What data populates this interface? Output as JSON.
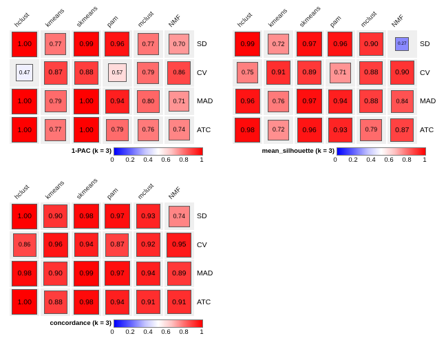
{
  "columns": [
    "hclust",
    "kmeans",
    "skmeans",
    "pam",
    "mclust",
    "NMF"
  ],
  "rows": [
    "SD",
    "CV",
    "MAD",
    "ATC"
  ],
  "legend_ticks": [
    "0",
    "0.2",
    "0.4",
    "0.6",
    "0.8",
    "1"
  ],
  "legend_tick_values": [
    0,
    0.2,
    0.4,
    0.6,
    0.8,
    1
  ],
  "chart_data": [
    {
      "type": "heatmap",
      "title": "1-PAC (k = 3)",
      "xlabel": "",
      "ylabel": "",
      "categories": [
        "hclust",
        "kmeans",
        "skmeans",
        "pam",
        "mclust",
        "NMF"
      ],
      "rows": [
        "SD",
        "CV",
        "MAD",
        "ATC"
      ],
      "zlim": [
        0,
        1
      ],
      "colormap": "blue-white-red",
      "legend_position": "bottom",
      "grid": true,
      "values": [
        [
          1.0,
          0.77,
          0.99,
          0.96,
          0.77,
          0.7
        ],
        [
          0.47,
          0.87,
          0.88,
          0.57,
          0.79,
          0.86
        ],
        [
          1.0,
          0.79,
          1.0,
          0.94,
          0.8,
          0.71
        ],
        [
          1.0,
          0.77,
          1.0,
          0.79,
          0.76,
          0.74
        ]
      ],
      "labels": [
        [
          "1.00",
          "0.77",
          "0.99",
          "0.96",
          "0.77",
          "0.70"
        ],
        [
          "0.47",
          "0.87",
          "0.88",
          "0.57",
          "0.79",
          "0.86"
        ],
        [
          "1.00",
          "0.79",
          "1.00",
          "0.94",
          "0.80",
          "0.71"
        ],
        [
          "1.00",
          "0.77",
          "1.00",
          "0.79",
          "0.76",
          "0.74"
        ]
      ]
    },
    {
      "type": "heatmap",
      "title": "mean_silhouette (k = 3)",
      "xlabel": "",
      "ylabel": "",
      "categories": [
        "hclust",
        "kmeans",
        "skmeans",
        "pam",
        "mclust",
        "NMF"
      ],
      "rows": [
        "SD",
        "CV",
        "MAD",
        "ATC"
      ],
      "zlim": [
        0,
        1
      ],
      "colormap": "blue-white-red",
      "legend_position": "bottom",
      "grid": true,
      "values": [
        [
          0.99,
          0.72,
          0.97,
          0.96,
          0.9,
          0.27
        ],
        [
          0.75,
          0.91,
          0.89,
          0.71,
          0.88,
          0.9
        ],
        [
          0.96,
          0.76,
          0.97,
          0.94,
          0.88,
          0.84
        ],
        [
          0.98,
          0.72,
          0.96,
          0.93,
          0.79,
          0.87
        ]
      ],
      "labels": [
        [
          "0.99",
          "0.72",
          "0.97",
          "0.96",
          "0.90",
          "0.27"
        ],
        [
          "0.75",
          "0.91",
          "0.89",
          "0.71",
          "0.88",
          "0.90"
        ],
        [
          "0.96",
          "0.76",
          "0.97",
          "0.94",
          "0.88",
          "0.84"
        ],
        [
          "0.98",
          "0.72",
          "0.96",
          "0.93",
          "0.79",
          "0.87"
        ]
      ]
    },
    {
      "type": "heatmap",
      "title": "concordance (k = 3)",
      "xlabel": "",
      "ylabel": "",
      "categories": [
        "hclust",
        "kmeans",
        "skmeans",
        "pam",
        "mclust",
        "NMF"
      ],
      "rows": [
        "SD",
        "CV",
        "MAD",
        "ATC"
      ],
      "zlim": [
        0,
        1
      ],
      "colormap": "blue-white-red",
      "legend_position": "bottom",
      "grid": true,
      "values": [
        [
          1.0,
          0.9,
          0.98,
          0.97,
          0.93,
          0.74
        ],
        [
          0.86,
          0.96,
          0.94,
          0.87,
          0.92,
          0.95
        ],
        [
          0.98,
          0.9,
          0.99,
          0.97,
          0.94,
          0.89
        ],
        [
          1.0,
          0.88,
          0.98,
          0.94,
          0.91,
          0.91
        ]
      ],
      "labels": [
        [
          "1.00",
          "0.90",
          "0.98",
          "0.97",
          "0.93",
          "0.74"
        ],
        [
          "0.86",
          "0.96",
          "0.94",
          "0.87",
          "0.92",
          "0.95"
        ],
        [
          "0.98",
          "0.90",
          "0.99",
          "0.97",
          "0.94",
          "0.89"
        ],
        [
          "1.00",
          "0.88",
          "0.98",
          "0.94",
          "0.91",
          "0.91"
        ]
      ]
    }
  ]
}
